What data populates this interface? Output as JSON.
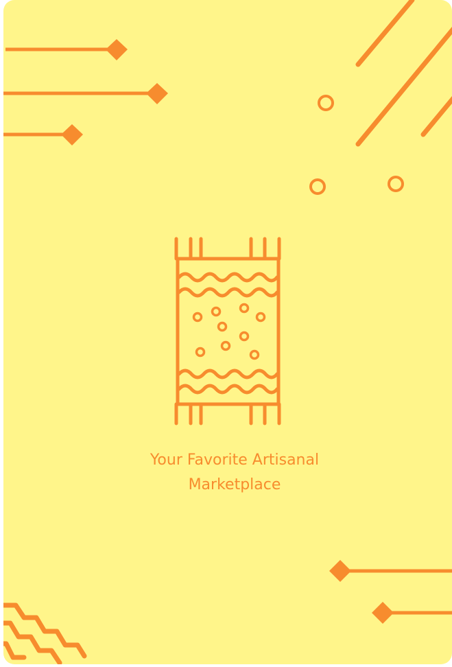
{
  "splash": {
    "tagline_line1": "Your Favorite Artisanal",
    "tagline_line2": "Marketplace"
  },
  "logo": {
    "icon": "woven-rug-icon"
  },
  "colors": {
    "background": "#FFF58A",
    "accent": "#F78C2E"
  }
}
